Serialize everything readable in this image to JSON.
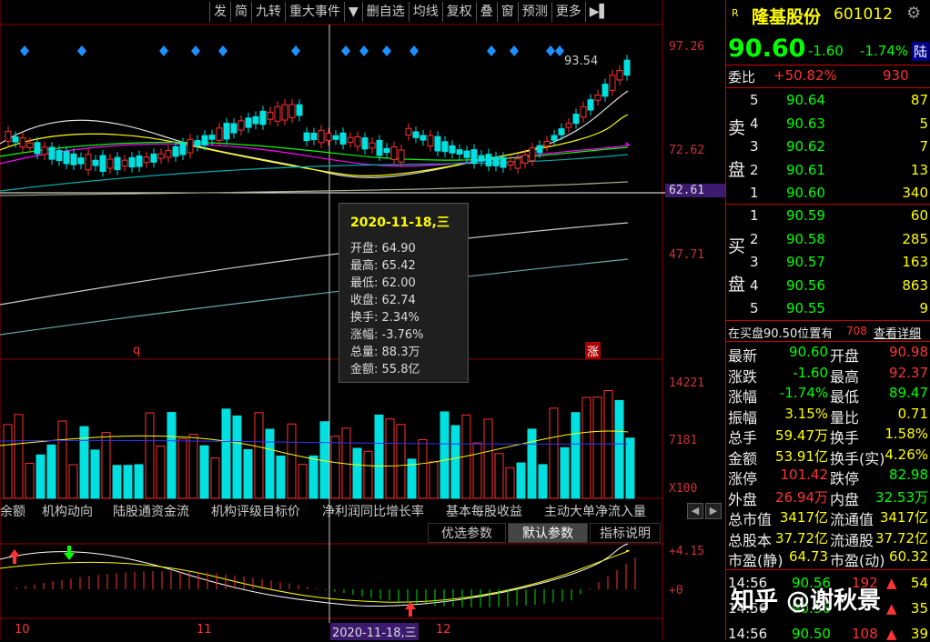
{
  "toolbar": {
    "items": [
      "发",
      "简",
      "九转",
      "重大事件",
      "▼",
      "删自选",
      "均线",
      "复权",
      "叠",
      "窗",
      "预测",
      "更多",
      "▶▌"
    ]
  },
  "price_axis": {
    "p1": "97.26",
    "p2": "72.62",
    "p3": "62.61",
    "p4": "47.71",
    "vol_hi": "14221",
    "vol_mid": "7181",
    "vol_unit": "X100",
    "ind_hi": "+4.15",
    "ind_zero": "+0"
  },
  "chart": {
    "peak_label": "93.54",
    "marker_q": "q",
    "marker_zhang": "涨",
    "date_ticks": [
      "10",
      "11",
      "12"
    ],
    "crosshair_date": "2020-11-18,三"
  },
  "tooltip": {
    "title": "2020-11-18,三",
    "rows": [
      {
        "k": "开盘",
        "v": "64.90"
      },
      {
        "k": "最高",
        "v": "65.42"
      },
      {
        "k": "最低",
        "v": "62.00"
      },
      {
        "k": "收盘",
        "v": "62.74"
      },
      {
        "k": "换手",
        "v": "2.34%"
      },
      {
        "k": "涨幅",
        "v": "-3.76%"
      },
      {
        "k": "总量",
        "v": "88.3万"
      },
      {
        "k": "金额",
        "v": "55.8亿"
      }
    ]
  },
  "tabs": [
    "余额",
    "机构动向",
    "陆股通资金流",
    "机构评级目标价",
    "净利润同比增长率",
    "基本每股收益",
    "主动大单净流入量"
  ],
  "param_buttons": [
    "优选参数",
    "默认参数",
    "指标说明"
  ],
  "quote": {
    "market": "R",
    "name": "隆基股份",
    "code": "601012",
    "price": "90.60",
    "change": "-1.60",
    "pct": "-1.74%",
    "tag": "陆",
    "weibi_label": "委比",
    "weibi": "+50.82%",
    "weicha": "930",
    "sell_label": [
      "卖",
      "盘"
    ],
    "buy_label": [
      "买",
      "盘"
    ],
    "sell": [
      {
        "n": "5",
        "p": "90.64",
        "v": "87"
      },
      {
        "n": "4",
        "p": "90.63",
        "v": "5"
      },
      {
        "n": "3",
        "p": "90.62",
        "v": "7"
      },
      {
        "n": "2",
        "p": "90.61",
        "v": "13"
      },
      {
        "n": "1",
        "p": "90.60",
        "v": "340"
      }
    ],
    "buy": [
      {
        "n": "1",
        "p": "90.59",
        "v": "60"
      },
      {
        "n": "2",
        "p": "90.58",
        "v": "285"
      },
      {
        "n": "3",
        "p": "90.57",
        "v": "163"
      },
      {
        "n": "4",
        "p": "90.56",
        "v": "863"
      },
      {
        "n": "5",
        "p": "90.55",
        "v": "9"
      }
    ],
    "notice": "在买盘90.50位置有",
    "notice_num": "708",
    "notice_link": "查看详细",
    "stats": [
      {
        "a": "最新",
        "av": "90.60",
        "b": "开盘",
        "bv": "90.98"
      },
      {
        "a": "涨跌",
        "av": "-1.60",
        "b": "最高",
        "bv": "92.37"
      },
      {
        "a": "涨幅",
        "av": "-1.74%",
        "b": "最低",
        "bv": "89.47"
      },
      {
        "a": "振幅",
        "av": "3.15%",
        "b": "量比",
        "bv": "0.71"
      },
      {
        "a": "总手",
        "av": "59.47万",
        "b": "换手",
        "bv": "1.58%"
      },
      {
        "a": "金额",
        "av": "53.91亿",
        "b": "换手(实)",
        "bv": "4.26%"
      },
      {
        "a": "涨停",
        "av": "101.42",
        "b": "跌停",
        "bv": "82.98"
      },
      {
        "a": "外盘",
        "av": "26.94万",
        "b": "内盘",
        "bv": "32.53万"
      },
      {
        "a": "总市值",
        "av": "3417亿",
        "b": "流通值",
        "bv": "3417亿"
      },
      {
        "a": "总股本",
        "av": "37.72亿",
        "b": "流通股",
        "bv": "37.72亿"
      },
      {
        "a": "市盈(静)",
        "av": "64.73",
        "b": "市盈(动)",
        "bv": "60.32"
      }
    ],
    "ticks": [
      {
        "t": "14:56",
        "p": "90.56",
        "v": "192",
        "u": "54"
      },
      {
        "t": "14:56",
        "p": "90.56",
        "v": "",
        "u": "35"
      },
      {
        "t": "14:56",
        "p": "90.50",
        "v": "108",
        "u": "39"
      }
    ]
  },
  "watermark": "知乎 @谢秋景",
  "colors": {
    "up": "#ff3030",
    "down": "#00e0e0",
    "grid": "#8b0000"
  }
}
